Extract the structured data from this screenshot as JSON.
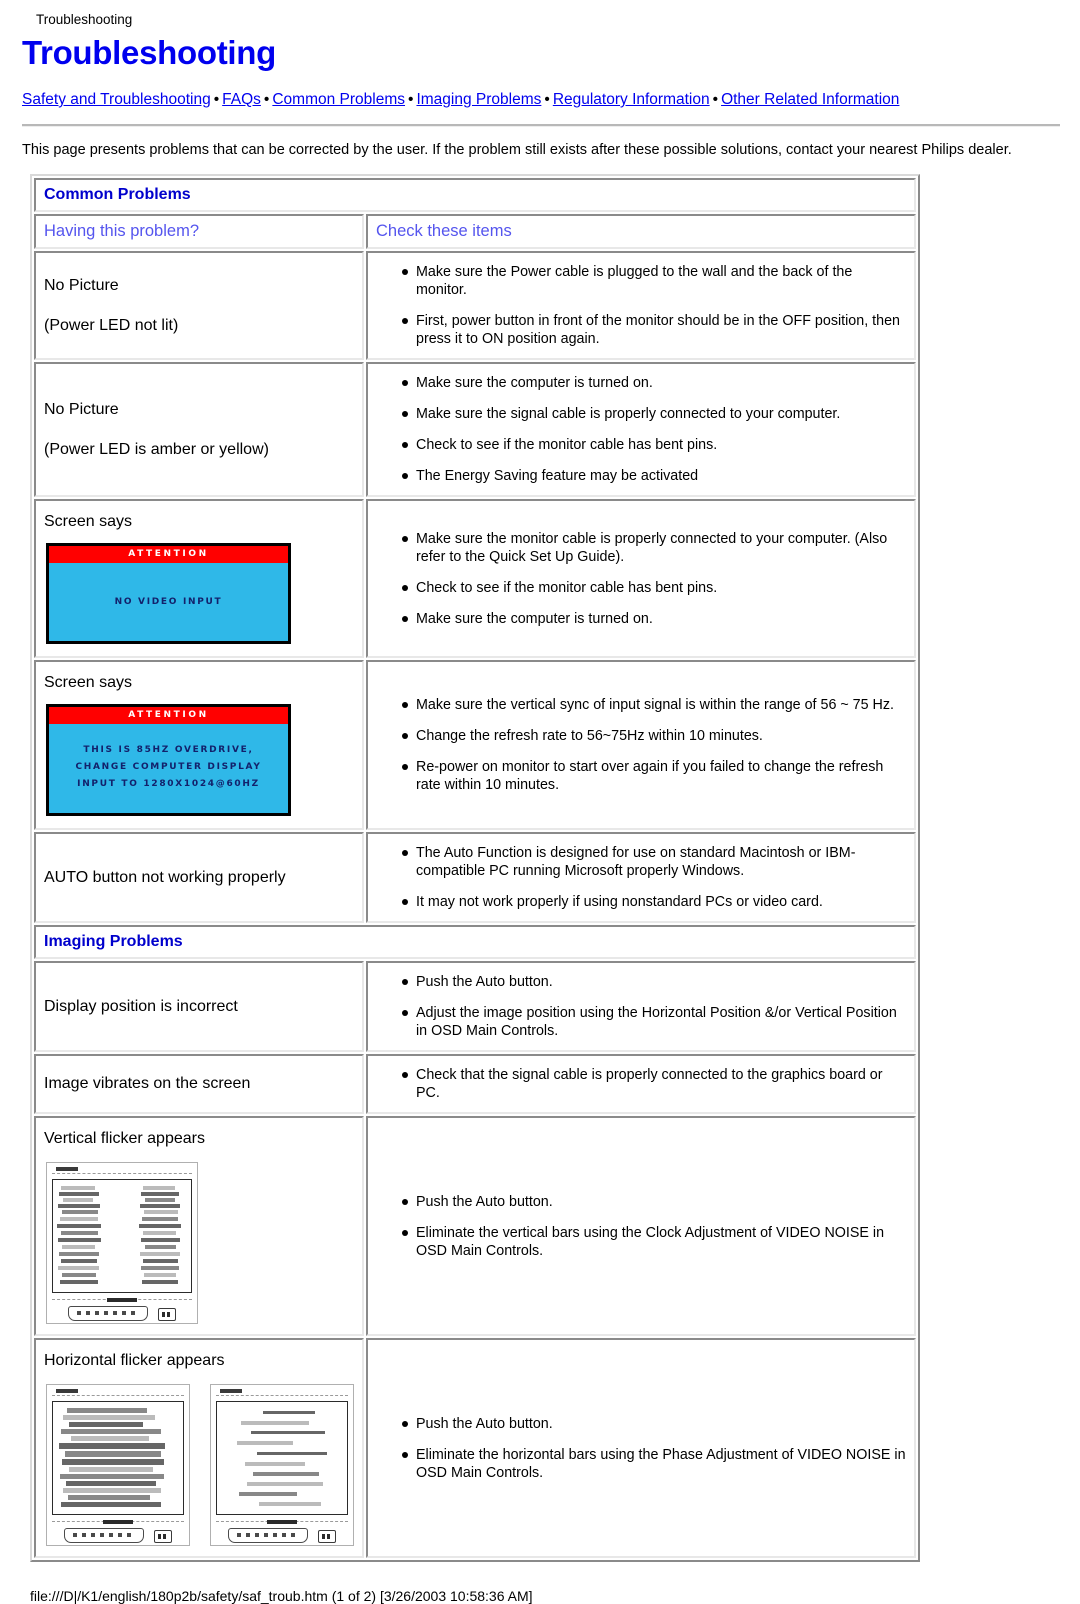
{
  "breadcrumb": "Troubleshooting",
  "page_title": "Troubleshooting",
  "nav": {
    "separator": "•",
    "links": [
      "Safety and Troubleshooting",
      "FAQs",
      "Common Problems",
      "Imaging Problems",
      "Regulatory Information",
      "Other Related Information"
    ]
  },
  "intro": "This page presents problems that can be corrected by the user. If the problem still exists after these possible solutions, contact your nearest Philips dealer.",
  "table": {
    "common_problems_heading": "Common Problems",
    "imaging_problems_heading": "Imaging Problems",
    "col_headers": {
      "left": "Having this problem?",
      "right": "Check these items"
    },
    "rows": {
      "r1": {
        "problem_line1": "No Picture",
        "problem_line2": "(Power LED not lit)",
        "checks": [
          "Make sure the Power cable is plugged to the wall and the back of the monitor.",
          "First, power button in front of the monitor should be in the OFF position, then press it to ON position again."
        ]
      },
      "r2": {
        "problem_line1": "No Picture",
        "problem_line2": "(Power LED is amber or yellow)",
        "checks": [
          "Make sure the computer is turned on.",
          "Make sure the signal cable is properly connected to your computer.",
          "Check to see if the monitor cable has bent pins.",
          "The Energy Saving feature may be activated"
        ]
      },
      "r3": {
        "problem_line1": "Screen says",
        "osd": {
          "attention": "ATTENTION",
          "message": "NO VIDEO INPUT"
        },
        "checks": [
          "Make sure the monitor cable is properly connected to your computer. (Also refer to the Quick Set Up Guide).",
          "Check to see if the monitor cable has bent pins.",
          "Make sure the computer is turned on."
        ]
      },
      "r4": {
        "problem_line1": "Screen says",
        "osd": {
          "attention": "ATTENTION",
          "message_line1": "THIS IS 85HZ OVERDRIVE,",
          "message_line2": "CHANGE COMPUTER DISPLAY",
          "message_line3": "INPUT TO 1280X1024@60HZ"
        },
        "checks": [
          "Make sure the vertical sync of input signal is within the range of 56 ~ 75 Hz.",
          "Change the refresh rate to 56~75Hz within 10 minutes.",
          "Re-power on monitor to start over again if you failed to change the refresh rate within 10 minutes."
        ]
      },
      "r5": {
        "problem_line1": "AUTO button not working properly",
        "checks": [
          "The Auto Function is designed for use on standard Macintosh or IBM-compatible PC running Microsoft properly Windows.",
          "It may not work properly if using nonstandard PCs or video card."
        ]
      },
      "r6": {
        "problem_line1": "Display position is incorrect",
        "checks": [
          "Push the Auto button.",
          "Adjust the image position using the Horizontal Position &/or Vertical Position in OSD Main Controls."
        ]
      },
      "r7": {
        "problem_line1": "Image vibrates on the screen",
        "checks": [
          "Check that the signal cable is properly connected to the graphics board or PC."
        ]
      },
      "r8": {
        "problem_line1": "Vertical flicker appears",
        "checks": [
          "Push the Auto button.",
          "Eliminate the vertical bars using the Clock Adjustment of VIDEO NOISE in OSD Main Controls."
        ]
      },
      "r9": {
        "problem_line1": "Horizontal flicker appears",
        "checks": [
          "Push the Auto button.",
          "Eliminate the horizontal bars using the Phase Adjustment of VIDEO NOISE in OSD Main Controls."
        ]
      }
    }
  },
  "footer": "file:///D|/K1/english/180p2b/safety/saf_troub.htm (1 of 2) [3/26/2003 10:58:36 AM]",
  "colors": {
    "link": "#0000EE",
    "heading_blue": "#0000CC",
    "colhead_blue": "#5555EE",
    "osd_attention_bg": "#FF0000",
    "osd_body_bg": "#2FB8E8",
    "osd_text": "#13216B"
  }
}
